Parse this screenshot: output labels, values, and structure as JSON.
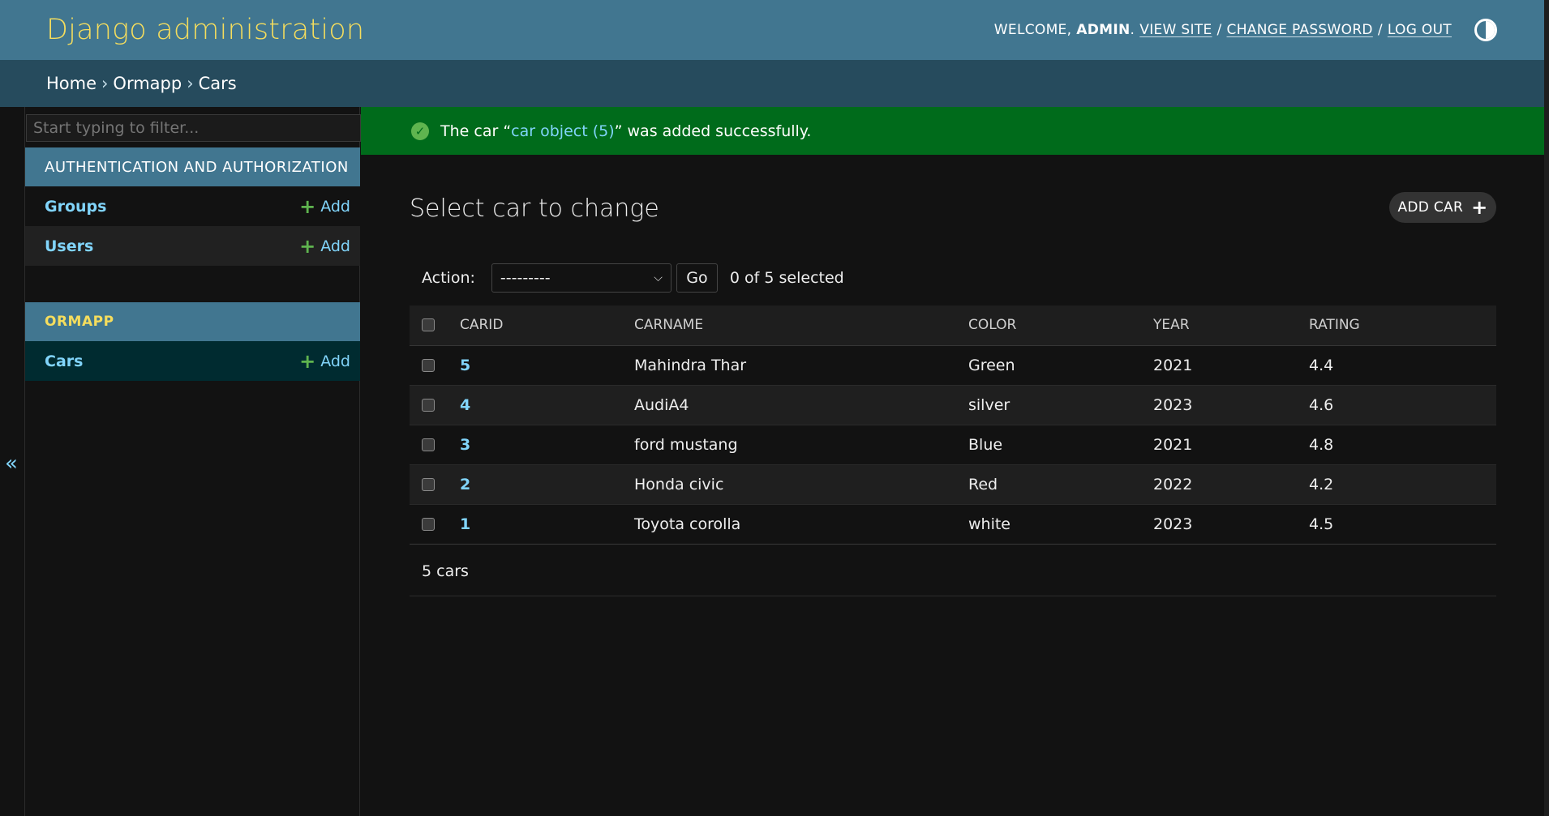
{
  "header": {
    "site_name": "Django administration",
    "welcome": "Welcome,",
    "username": "admin",
    "username_suffix": ".",
    "view_site": "View site",
    "change_password": "Change password",
    "log_out": "Log out",
    "separator": "/"
  },
  "breadcrumbs": {
    "home": "Home",
    "app": "Ormapp",
    "current": "Cars",
    "arrow": "›"
  },
  "sidebar": {
    "filter_placeholder": "Start typing to filter...",
    "toggle_label": "«",
    "modules": [
      {
        "caption": "Authentication and Authorization",
        "models": [
          {
            "name": "Groups",
            "add": "Add"
          },
          {
            "name": "Users",
            "add": "Add"
          }
        ]
      },
      {
        "caption": "Ormapp",
        "models": [
          {
            "name": "Cars",
            "add": "Add"
          }
        ]
      }
    ]
  },
  "message": {
    "prefix": "The car “",
    "link": "car object (5)",
    "suffix": "” was added successfully."
  },
  "content": {
    "title": "Select car to change",
    "add_button": "Add car",
    "action_label": "Action:",
    "action_selected": "---------",
    "go_button": "Go",
    "selected_counter": "0 of 5 selected",
    "columns": [
      "Carid",
      "Carname",
      "Color",
      "Year",
      "Rating"
    ],
    "rows": [
      {
        "carid": "5",
        "carname": "Mahindra Thar",
        "color": "Green",
        "year": "2021",
        "rating": "4.4"
      },
      {
        "carid": "4",
        "carname": "AudiA4",
        "color": "silver",
        "year": "2023",
        "rating": "4.6"
      },
      {
        "carid": "3",
        "carname": "ford mustang",
        "color": "Blue",
        "year": "2021",
        "rating": "4.8"
      },
      {
        "carid": "2",
        "carname": "Honda civic",
        "color": "Red",
        "year": "2022",
        "rating": "4.2"
      },
      {
        "carid": "1",
        "carname": "Toyota corolla",
        "color": "white",
        "year": "2023",
        "rating": "4.5"
      }
    ],
    "paginator": "5 cars"
  },
  "colors": {
    "header_bg": "#417690",
    "breadcrumb_bg": "#264b5d",
    "site_name": "#f5dd5d",
    "link": "#81d4fa",
    "success_bg": "#006b1b",
    "add_icon": "#5fb44f"
  }
}
